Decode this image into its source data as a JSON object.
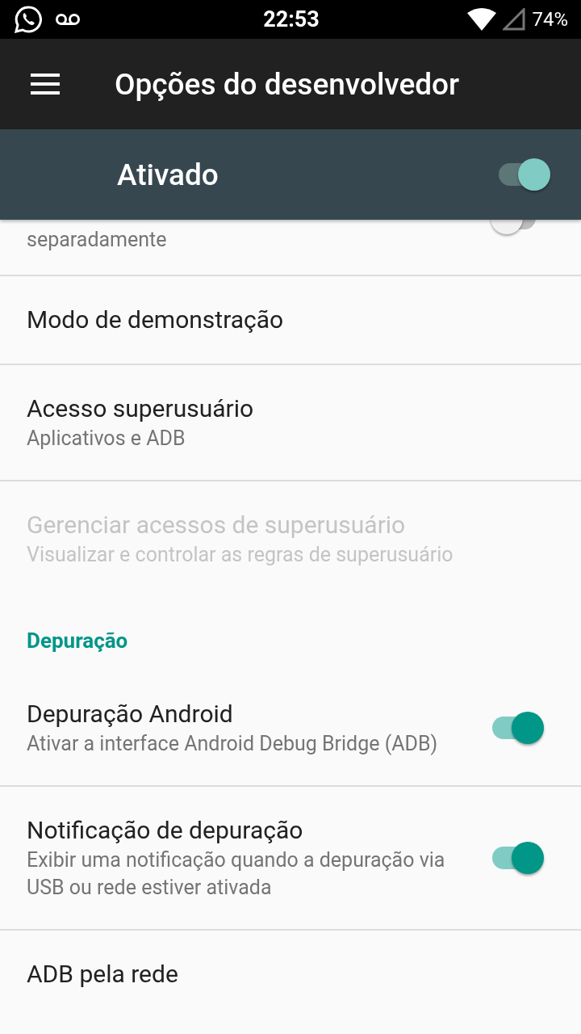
{
  "status_bar": {
    "time": "22:53",
    "battery": "74%"
  },
  "toolbar": {
    "title": "Opções do desenvolvedor"
  },
  "master_switch": {
    "label": "Ativado",
    "on": true
  },
  "items": [
    {
      "kind": "switch",
      "summary": "separadamente",
      "on": false
    },
    {
      "kind": "plain",
      "title": "Modo de demonstração",
      "disabled": false
    },
    {
      "kind": "plain",
      "title": "Acesso superusuário",
      "summary": "Aplicativos e ADB",
      "disabled": false
    },
    {
      "kind": "plain",
      "title": "Gerenciar acessos de superusuário",
      "summary": "Visualizar e controlar as regras de superusuário",
      "disabled": true
    },
    {
      "kind": "category",
      "title": "Depuração"
    },
    {
      "kind": "switch",
      "title": "Depuração Android",
      "summary": "Ativar a interface Android Debug Bridge (ADB)",
      "on": true
    },
    {
      "kind": "switch",
      "title": "Notificação de depuração",
      "summary": "Exibir uma notificação quando a depuração via USB ou rede estiver ativada",
      "on": true
    },
    {
      "kind": "plain",
      "title": "ADB pela rede",
      "disabled": false
    }
  ]
}
